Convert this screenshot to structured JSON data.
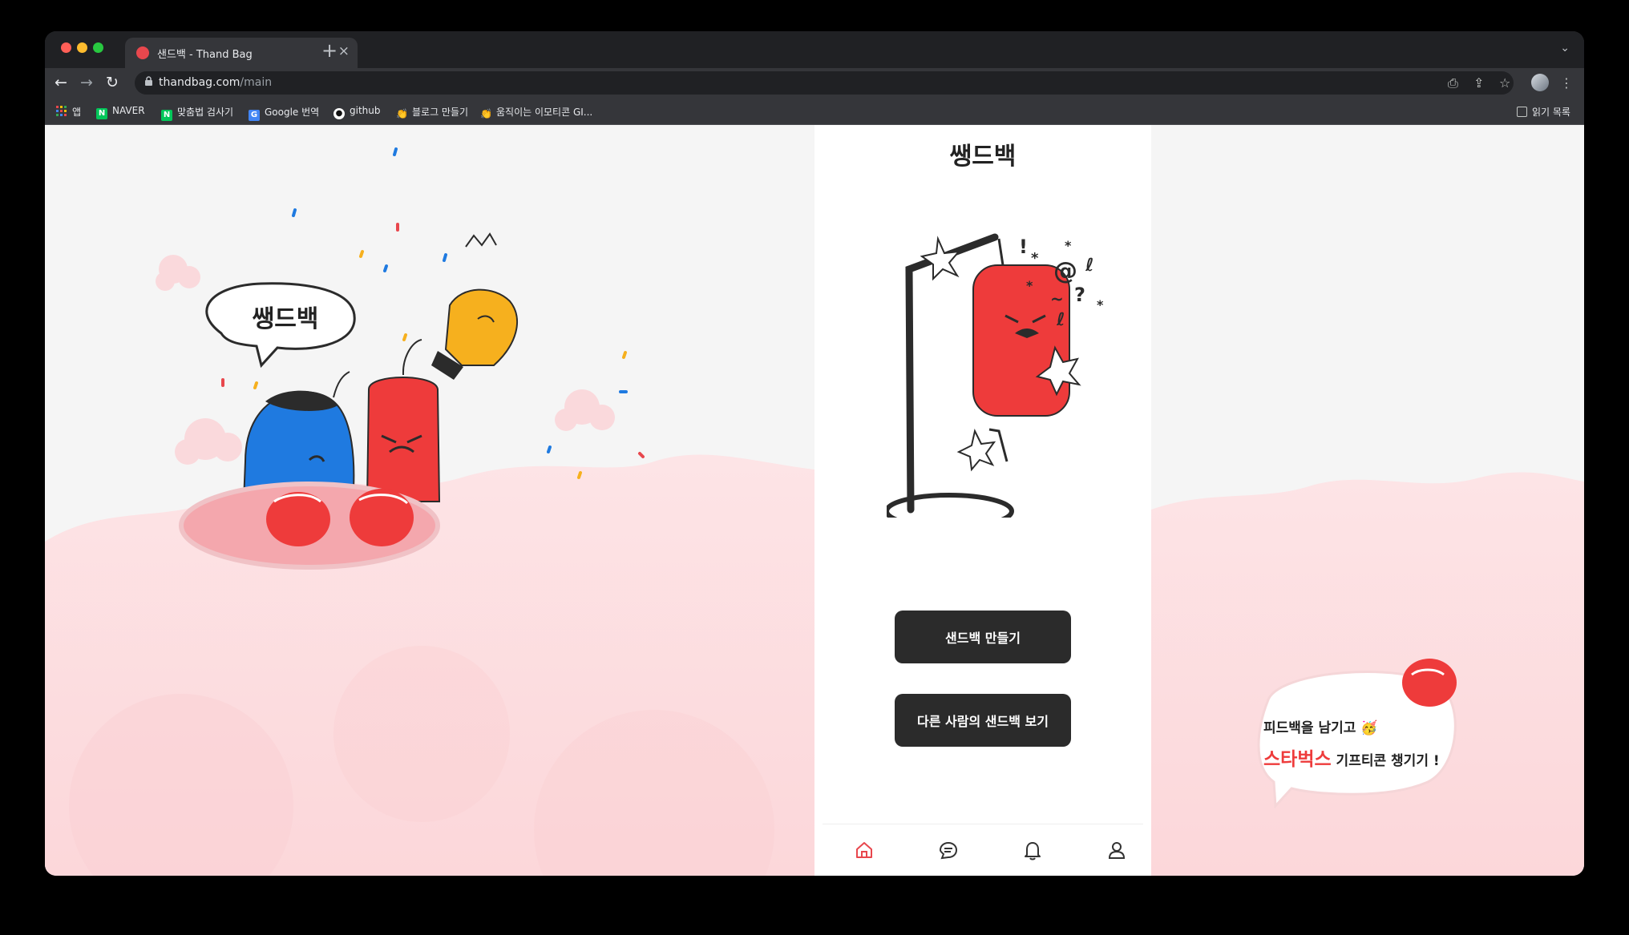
{
  "browser": {
    "tab_title": "샌드백 - Thand Bag",
    "tab_close": "×",
    "new_tab": "+",
    "tab_search": "⌄",
    "url_host": "thandbag.com",
    "url_path": "/main",
    "lock": "🔒",
    "back": "←",
    "forward": "→",
    "reload": "↻",
    "toolbar_icons": {
      "install": "⎙",
      "share": "⇪",
      "bookmark_star": "☆",
      "menu": "⋮"
    },
    "bookmarks": [
      {
        "label": "앱",
        "icon_name": "apps-grid-icon"
      },
      {
        "label": "NAVER",
        "icon_name": "naver-icon"
      },
      {
        "label": "맞춤법 검사기",
        "icon_name": "naver-icon"
      },
      {
        "label": "Google 번역",
        "icon_name": "google-translate-icon"
      },
      {
        "label": "github",
        "icon_name": "github-icon"
      },
      {
        "label": "블로그 만들기",
        "icon_name": "clap-hand-icon"
      },
      {
        "label": "움직이는 이모티콘 GI...",
        "icon_name": "clap-hand-icon"
      }
    ],
    "reading_list": "읽기 목록"
  },
  "left_panel": {
    "logo_text": "쌩드백"
  },
  "app": {
    "logo": "쌩드백",
    "create_button": "샌드백 만들기",
    "browse_button": "다른 사람의 샌드백 보기",
    "nav": [
      {
        "name": "home",
        "active": true
      },
      {
        "name": "chat",
        "active": false
      },
      {
        "name": "notification",
        "active": false
      },
      {
        "name": "profile",
        "active": false
      }
    ],
    "accent_color": "#e8474d"
  },
  "promo": {
    "line1": "피드백을 남기고 🥳",
    "starbucks": "스타벅스",
    "line2_rest": " 기프티콘 챙기기 !"
  },
  "colors": {
    "background_pink": "#fde0e2",
    "button_dark": "#2b2b2b"
  }
}
